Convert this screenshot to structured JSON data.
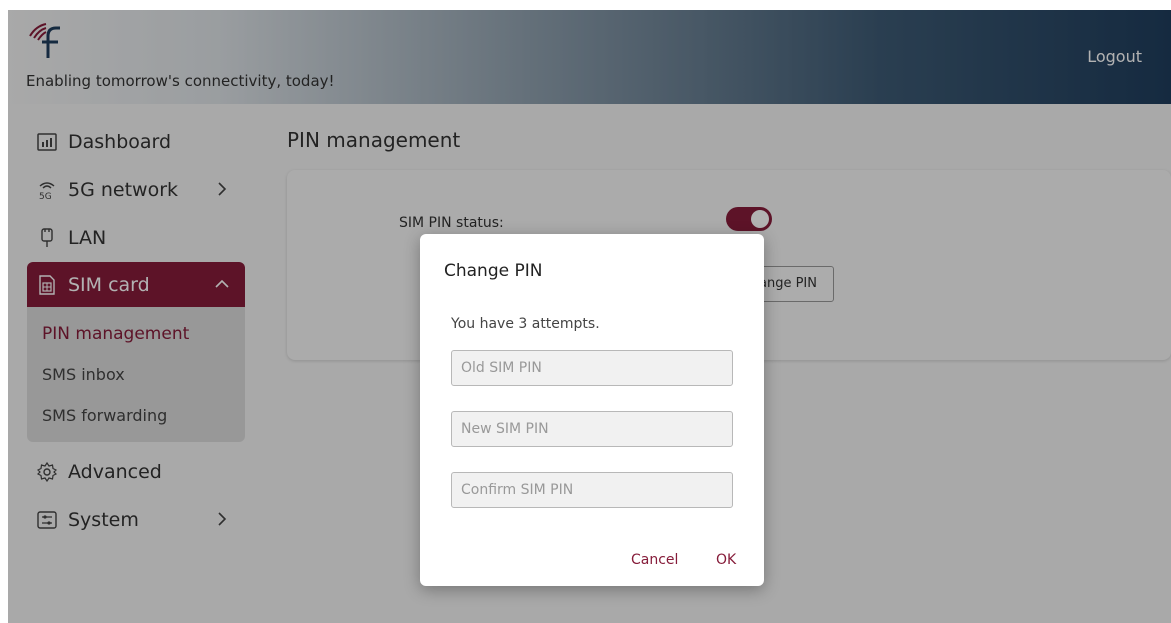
{
  "header": {
    "tagline": "Enabling tomorrow's connectivity, today!",
    "logout_label": "Logout"
  },
  "sidebar": {
    "items": [
      {
        "label": "Dashboard",
        "icon": "dashboard-icon"
      },
      {
        "label": "5G network",
        "icon": "5g-signal-icon"
      },
      {
        "label": "LAN",
        "icon": "ethernet-plug-icon"
      },
      {
        "label": "SIM card",
        "icon": "sim-card-icon"
      },
      {
        "label": "Advanced",
        "icon": "gear-icon"
      },
      {
        "label": "System",
        "icon": "sliders-icon"
      }
    ],
    "sim_subitems": [
      {
        "label": "PIN management"
      },
      {
        "label": "SMS inbox"
      },
      {
        "label": "SMS forwarding"
      }
    ]
  },
  "main": {
    "page_title": "PIN management",
    "pin_status_label": "SIM PIN status:",
    "change_pin_button": "ange PIN"
  },
  "modal": {
    "title": "Change PIN",
    "attempts_text": "You have 3 attempts.",
    "old_pin_placeholder": "Old SIM PIN",
    "new_pin_placeholder": "New SIM PIN",
    "confirm_pin_placeholder": "Confirm SIM PIN",
    "cancel_label": "Cancel",
    "ok_label": "OK"
  },
  "colors": {
    "accent": "#861c3a",
    "header_dark": "#1f3d5c"
  }
}
